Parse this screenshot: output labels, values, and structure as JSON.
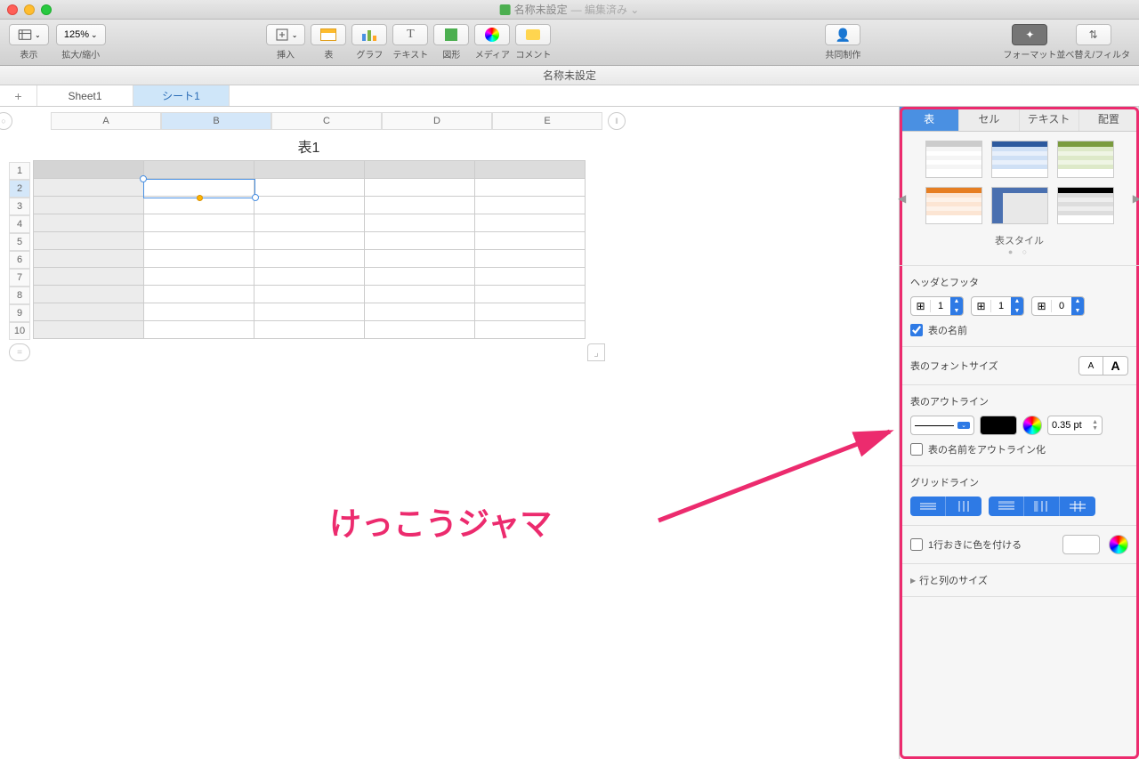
{
  "window": {
    "title": "名称未設定",
    "status": "— 編集済み ⌄"
  },
  "toolbar": {
    "view": "表示",
    "zoom_value": "125%",
    "zoom_label": "拡大/縮小",
    "insert": "挿入",
    "table": "表",
    "chart": "グラフ",
    "text": "テキスト",
    "shape": "図形",
    "media": "メディア",
    "comment": "コメント",
    "collaborate": "共同制作",
    "format": "フォーマット",
    "sort": "並べ替え/フィルタ"
  },
  "sheet_title": "名称未設定",
  "tabs": [
    "Sheet1",
    "シート1"
  ],
  "active_tab": 1,
  "columns": [
    "A",
    "B",
    "C",
    "D",
    "E"
  ],
  "selected_column": "B",
  "rows": [
    1,
    2,
    3,
    4,
    5,
    6,
    7,
    8,
    9,
    10
  ],
  "selected_row": 2,
  "table_title": "表1",
  "inspector": {
    "tabs": [
      "表",
      "セル",
      "テキスト",
      "配置"
    ],
    "active_tab": 0,
    "style_caption": "表スタイル",
    "header_footer": {
      "label": "ヘッダとフッタ",
      "header_rows": 1,
      "header_cols": 1,
      "footer_rows": 0
    },
    "table_name": {
      "checked": true,
      "label": "表の名前"
    },
    "font_size_label": "表のフォントサイズ",
    "outline": {
      "label": "表のアウトライン",
      "width": "0.35 pt",
      "outline_name_label": "表の名前をアウトライン化",
      "outline_name_checked": false
    },
    "gridlines_label": "グリッドライン",
    "alternating": {
      "label": "1行おきに色を付ける",
      "checked": false
    },
    "row_col_size": "行と列のサイズ"
  },
  "annotation": "けっこうジャマ"
}
